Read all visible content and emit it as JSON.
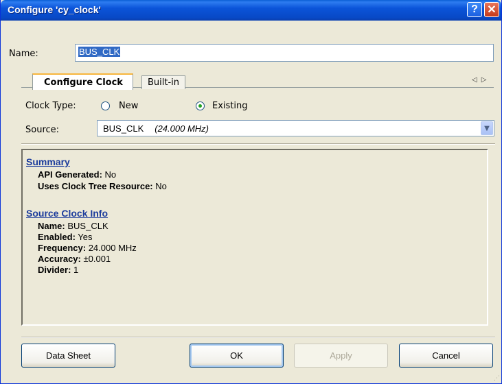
{
  "window": {
    "title": "Configure 'cy_clock'",
    "help_glyph": "?",
    "close_glyph": "✕"
  },
  "name_field": {
    "label": "Name:",
    "value": "BUS_CLK"
  },
  "tabs": [
    {
      "label": "Configure Clock",
      "active": true
    },
    {
      "label": "Built-in",
      "active": false
    }
  ],
  "tab_scroll": {
    "left_glyph": "◁",
    "right_glyph": "▷"
  },
  "clock_type": {
    "label": "Clock Type:",
    "options": [
      {
        "label": "New",
        "checked": false
      },
      {
        "label": "Existing",
        "checked": true
      }
    ]
  },
  "source": {
    "label": "Source:",
    "value": "BUS_CLK",
    "frequency": "(24.000 MHz)",
    "arrow_glyph": "▼"
  },
  "summary": {
    "heading": "Summary",
    "lines": [
      {
        "key": "API Generated:",
        "value": "No"
      },
      {
        "key": "Uses Clock Tree Resource:",
        "value": "No"
      }
    ]
  },
  "source_info": {
    "heading": "Source Clock Info",
    "lines": [
      {
        "key": "Name:",
        "value": "BUS_CLK"
      },
      {
        "key": "Enabled:",
        "value": "Yes"
      },
      {
        "key": "Frequency:",
        "value": "24.000 MHz"
      },
      {
        "key": "Accuracy:",
        "value": "±0.001"
      },
      {
        "key": "Divider:",
        "value": "1"
      }
    ]
  },
  "buttons": {
    "data_sheet": "Data Sheet",
    "ok": "OK",
    "apply": "Apply",
    "cancel": "Cancel"
  },
  "colors": {
    "title_bar": "#0b54d9",
    "link_heading": "#1c3c9c",
    "selection": "#316ac5",
    "radio_checked": "#21a121",
    "tab_highlight": "#f7b53b"
  }
}
